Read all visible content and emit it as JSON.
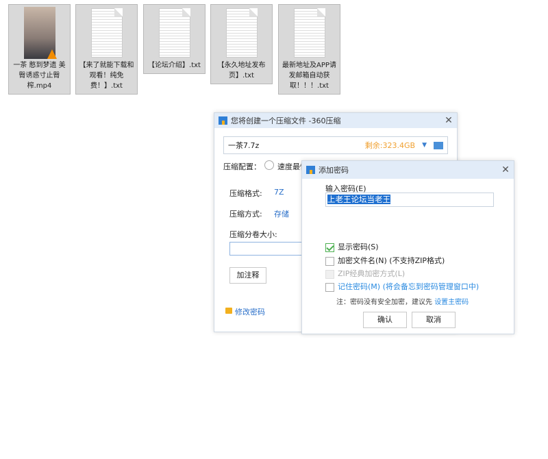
{
  "files": [
    {
      "name": "一茶 憨到梦遗 美臀诱惑寸止臀榨.mp4",
      "type": "video"
    },
    {
      "name": "【来了就能下载和观看！纯免费！】.txt",
      "type": "text"
    },
    {
      "name": "【论坛介绍】.txt",
      "type": "text"
    },
    {
      "name": "【永久地址发布页】.txt",
      "type": "text"
    },
    {
      "name": "最新地址及APP请发邮箱自动获取！！！.txt",
      "type": "text"
    }
  ],
  "main": {
    "title": "您将创建一个压缩文件 -360压缩",
    "filename": "一茶7.7z",
    "free_space": "剩余:323.4GB",
    "config_label": "压缩配置：",
    "config_option": "速度最快",
    "format_label": "压缩格式:",
    "format_value": "7Z",
    "method_label": "压缩方式:",
    "method_value": "存储",
    "split_label": "压缩分卷大小:",
    "split_value": "",
    "comment_button": "加注释",
    "change_password": "修改密码",
    "accent": "#f0a030"
  },
  "pw": {
    "title": "添加密码",
    "input_label": "输入密码(E)",
    "password": "上老王论坛当老王",
    "show_password": "显示密码(S)",
    "show_checked": true,
    "encrypt_names": "加密文件名(N) (不支持ZIP格式)",
    "zip_classic": "ZIP经典加密方式(L)",
    "remember": "记住密码(M) (将会备忘到密码管理窗口中)",
    "note": "注：密码没有安全加密，建议先",
    "note_link": "设置主密码",
    "ok": "确认",
    "cancel": "取消"
  }
}
